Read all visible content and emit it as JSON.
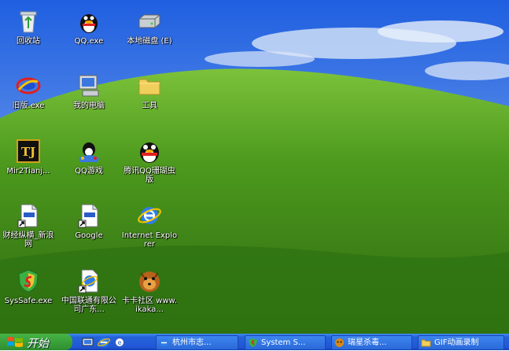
{
  "desktop": {
    "icons": [
      {
        "name": "recycle-bin-icon",
        "label": "回收站"
      },
      {
        "name": "qq-exe-icon",
        "label": "QQ.exe"
      },
      {
        "name": "local-disk-icon",
        "label": "本地磁盘 (E)"
      },
      {
        "name": "old-version-icon",
        "label": "旧版.exe"
      },
      {
        "name": "my-computer-icon",
        "label": "我的电脑"
      },
      {
        "name": "tools-folder-icon",
        "label": "工具"
      },
      {
        "name": "mir2tianji-icon",
        "label": "Mir2Tianj..."
      },
      {
        "name": "qq-game-icon",
        "label": "QQ游戏"
      },
      {
        "name": "qq-coral-icon",
        "label": "腾讯QQ珊瑚虫版"
      },
      {
        "name": "finance-sina-icon",
        "label": "财经纵横_新浪网"
      },
      {
        "name": "google-icon",
        "label": "Google"
      },
      {
        "name": "internet-explorer-icon",
        "label": "Internet Explorer"
      },
      {
        "name": "syssafe-icon",
        "label": "SysSafe.exe"
      },
      {
        "name": "china-unicom-icon",
        "label": "中国联通有限公司广东..."
      },
      {
        "name": "kaka-community-icon",
        "label": "卡卡社区 www.ikaka..."
      }
    ]
  },
  "taskbar": {
    "start_label": "开始",
    "tasks": [
      {
        "label": "杭州市志..."
      },
      {
        "label": "System S..."
      },
      {
        "label": "瑞星杀毒..."
      },
      {
        "label": "GIF动画录制"
      }
    ]
  }
}
